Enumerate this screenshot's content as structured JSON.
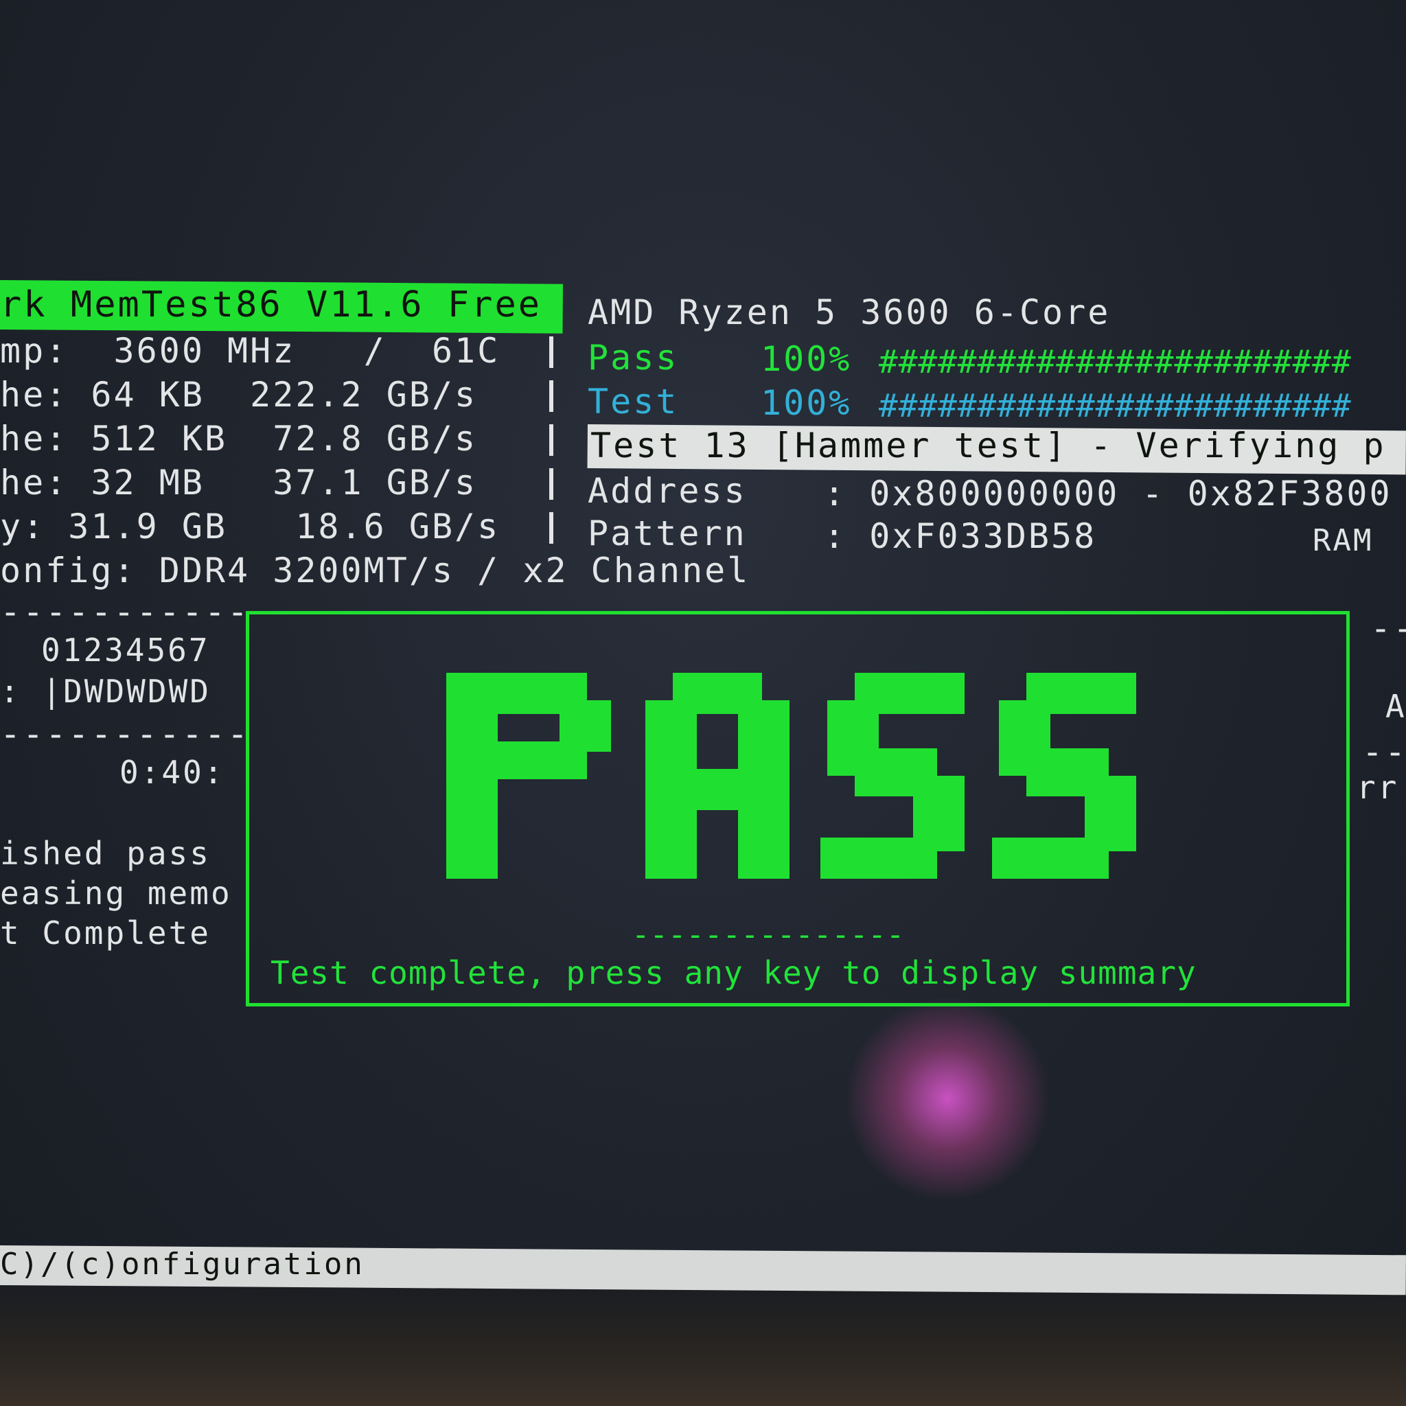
{
  "header": {
    "title": "rk MemTest86 V11.6 Free",
    "cpu": "AMD Ryzen 5 3600 6-Core"
  },
  "system": {
    "clk_temp": "mp:  3600 MHz   /  61C",
    "l1": "he: 64 KB  222.2 GB/s",
    "l2": "he: 512 KB  72.8 GB/s",
    "l3": "he: 32 MB   37.1 GB/s",
    "mem": "y: 31.9 GB   18.6 GB/s",
    "config": "onfig: DDR4 3200MT/s / x2 Channel"
  },
  "progress": {
    "pass_label": "Pass",
    "pass_pct": "100%",
    "pass_fill": 1.0,
    "pass_bar": "########################",
    "test_label": "Test",
    "test_pct": "100%",
    "test_fill": 1.0,
    "test_bar": "########################"
  },
  "current_test": {
    "name": "Test 13 [Hammer test] - Verifying p",
    "address_label": "Address",
    "address_value": ": 0x800000000 - 0x82F3800",
    "pattern_label": "Pattern",
    "pattern_value": ": 0xF033DB58",
    "ram_label": "RAM"
  },
  "cores": {
    "numbers": "01234567",
    "states": ": |DWDWDWD",
    "elapsed": "0:40:"
  },
  "log": {
    "line1": "ished pass",
    "line2": "easing memo",
    "line3": "t Complete"
  },
  "right_edge": {
    "char_a": "A",
    "frag": "rr"
  },
  "result": {
    "big_text": "PASS",
    "message": "Test complete, press any key to display summary"
  },
  "footer": {
    "text": "C)/(c)onfiguration"
  },
  "colors": {
    "green": "#1fe030",
    "cyan": "#33b0d8",
    "text": "#e2e4e6"
  }
}
